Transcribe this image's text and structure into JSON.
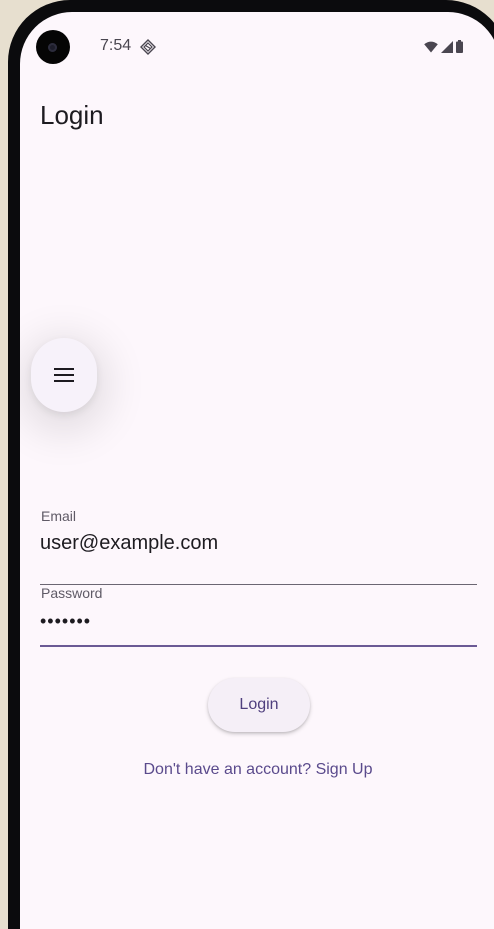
{
  "status_bar": {
    "time": "7:54"
  },
  "app_bar": {
    "title": "Login"
  },
  "form": {
    "email": {
      "label": "Email",
      "value": "user@example.com"
    },
    "password": {
      "label": "Password",
      "value": "•••••••"
    }
  },
  "actions": {
    "login_label": "Login",
    "signup_text": "Don't have an account? Sign Up"
  },
  "colors": {
    "background": "#fdf7fc",
    "accent": "#6b5a95",
    "link": "#5a4a8c"
  },
  "icons": {
    "menu": "menu-icon",
    "sync": "sync-icon",
    "wifi": "wifi-icon",
    "signal": "signal-icon",
    "battery": "battery-icon"
  }
}
